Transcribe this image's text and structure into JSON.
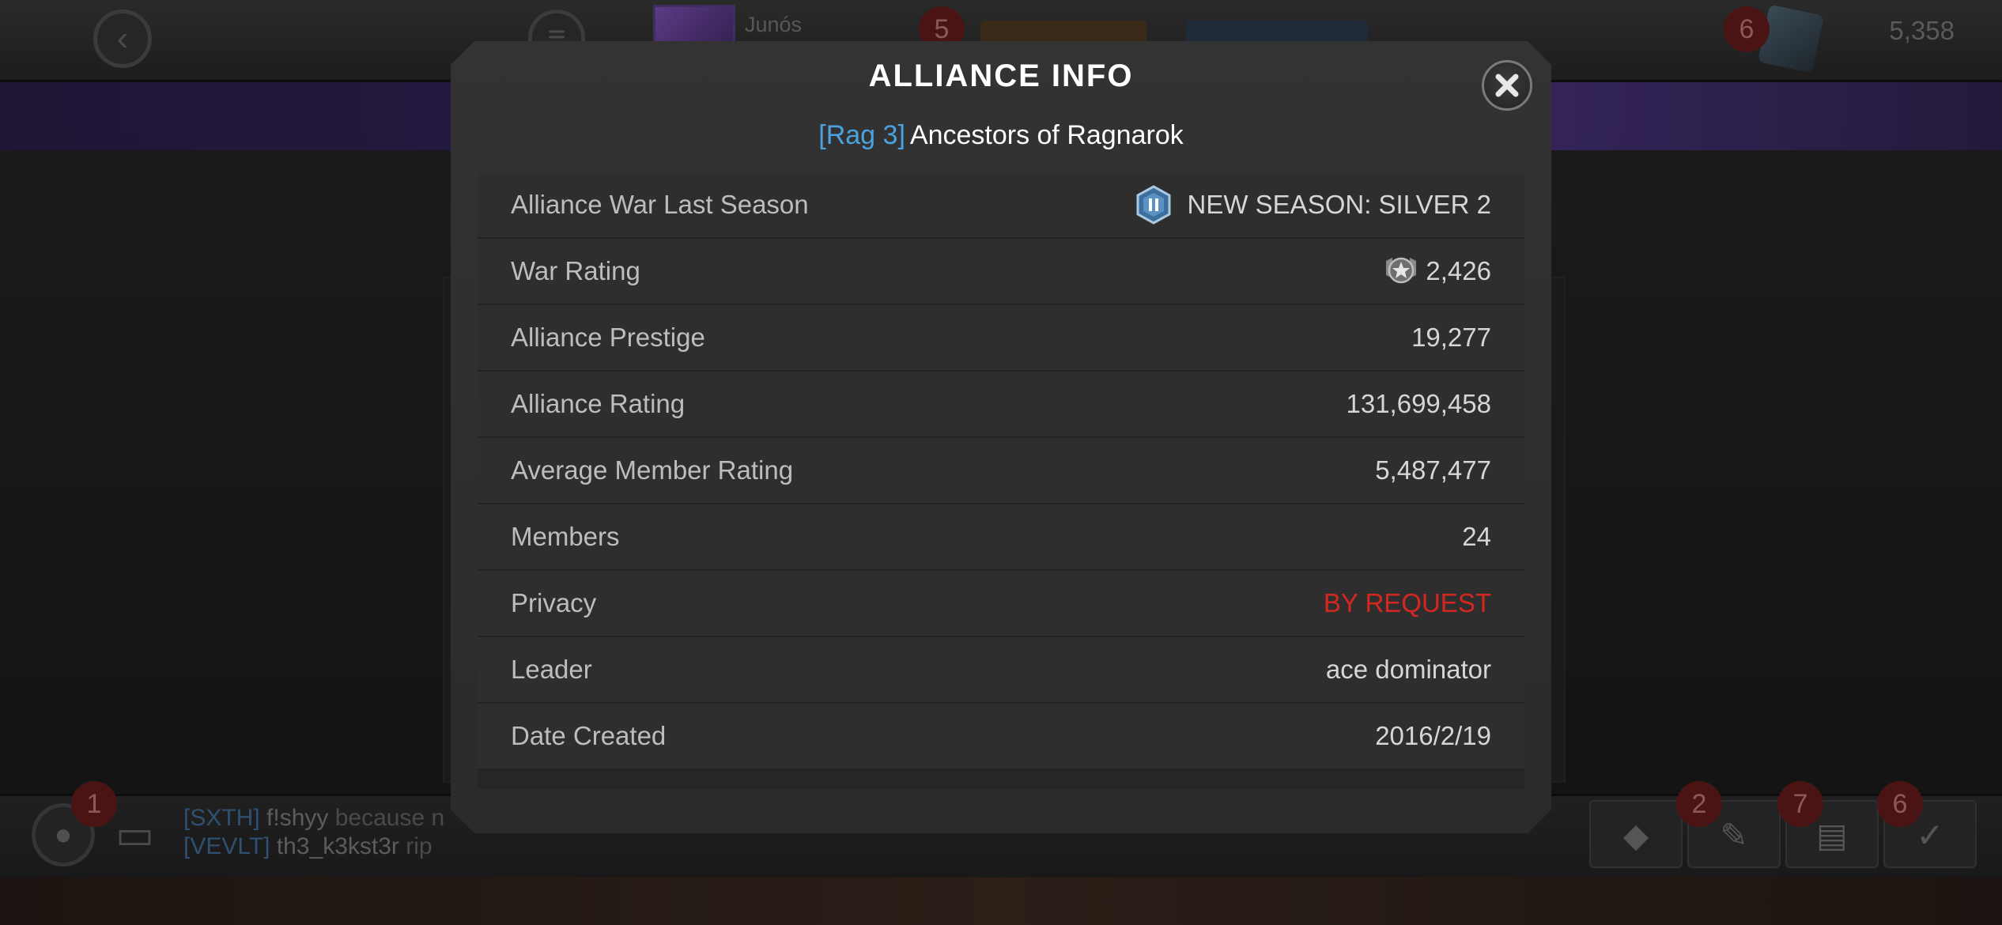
{
  "header": {
    "user_name": "Junós",
    "badge_quests": "5",
    "badge_units": "6",
    "resource_energy": "",
    "resource_gold": "",
    "units": "5,358"
  },
  "footer": {
    "badge_alliance": "1",
    "badge_item2": "2",
    "badge_item3": "7",
    "badge_item4": "6",
    "chat": [
      {
        "tag": "[SXTH]",
        "name": "f!shyy",
        "msg": "because n"
      },
      {
        "tag": "[VEVLT]",
        "name": "th3_k3kst3r",
        "msg": "rip"
      }
    ]
  },
  "modal": {
    "title": "ALLIANCE INFO",
    "tag": "[Rag 3]",
    "alliance_name": "Ancestors of Ragnarok",
    "rows": [
      {
        "label": "Alliance War Last Season",
        "value": "NEW SEASON: SILVER 2",
        "icon": "silver-tier-icon"
      },
      {
        "label": "War Rating",
        "value": "2,426",
        "icon": "war-rating-icon"
      },
      {
        "label": "Alliance Prestige",
        "value": "19,277"
      },
      {
        "label": "Alliance Rating",
        "value": "131,699,458"
      },
      {
        "label": "Average Member Rating",
        "value": "5,487,477"
      },
      {
        "label": "Members",
        "value": "24"
      },
      {
        "label": "Privacy",
        "value": "BY REQUEST",
        "color": "#d5271f"
      },
      {
        "label": "Leader",
        "value": "ace dominator"
      },
      {
        "label": "Date Created",
        "value": "2016/2/19"
      }
    ]
  }
}
